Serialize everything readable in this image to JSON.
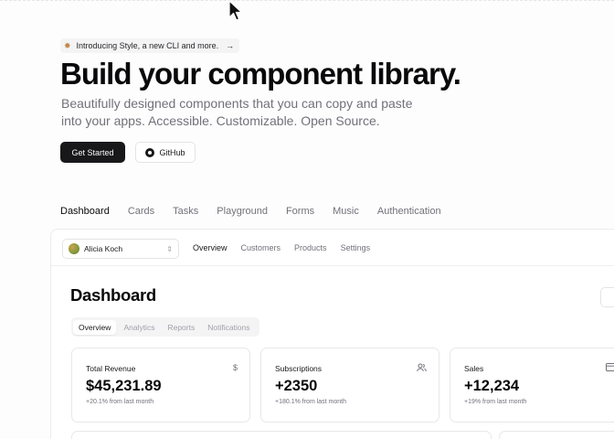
{
  "announcement": {
    "icon": "sparkle-icon",
    "text": "Introducing Style, a new CLI and more.",
    "arrow": "→"
  },
  "hero": {
    "title": "Build your component library.",
    "subtitle": "Beautifully designed components that you can copy and paste into your apps. Accessible. Customizable. Open Source.",
    "primary_button": "Get Started",
    "secondary_button": "GitHub"
  },
  "examples_nav": {
    "items": [
      {
        "label": "Dashboard",
        "active": true
      },
      {
        "label": "Cards"
      },
      {
        "label": "Tasks"
      },
      {
        "label": "Playground"
      },
      {
        "label": "Forms"
      },
      {
        "label": "Music"
      },
      {
        "label": "Authentication"
      }
    ]
  },
  "preview": {
    "team": {
      "name": "Alicia Koch",
      "chevron": "⌃⌄"
    },
    "main_nav": [
      {
        "label": "Overview",
        "active": true
      },
      {
        "label": "Customers"
      },
      {
        "label": "Products"
      },
      {
        "label": "Settings"
      }
    ],
    "title": "Dashboard",
    "tabs": [
      {
        "label": "Overview",
        "active": true
      },
      {
        "label": "Analytics"
      },
      {
        "label": "Reports"
      },
      {
        "label": "Notifications"
      }
    ],
    "cards": [
      {
        "label": "Total Revenue",
        "value": "$45,231.89",
        "sub": "+20.1% from last month",
        "icon": "dollar-icon"
      },
      {
        "label": "Subscriptions",
        "value": "+2350",
        "sub": "+180.1% from last month",
        "icon": "users-icon"
      },
      {
        "label": "Sales",
        "value": "+12,234",
        "sub": "+19% from last month",
        "icon": "credit-card-icon"
      }
    ]
  }
}
